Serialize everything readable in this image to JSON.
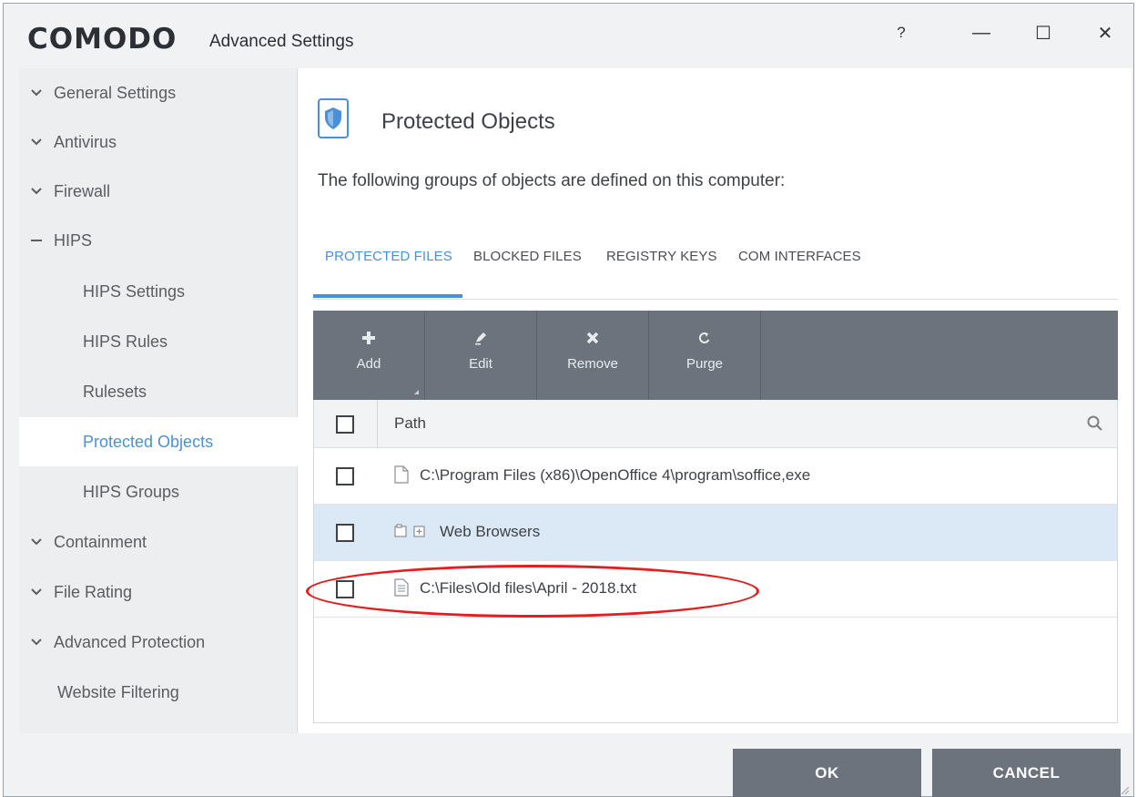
{
  "window": {
    "brand": "COMODO",
    "title": "Advanced Settings",
    "help_label": "?",
    "minimize_label": "—",
    "maximize_label": "☐",
    "close_label": "✕"
  },
  "sidebar": {
    "items": [
      {
        "label": "General Settings",
        "icon": "chevron-down-icon"
      },
      {
        "label": "Antivirus",
        "icon": "chevron-down-icon"
      },
      {
        "label": "Firewall",
        "icon": "chevron-down-icon"
      },
      {
        "label": "HIPS",
        "icon": "minus-icon"
      },
      {
        "label": "HIPS Settings"
      },
      {
        "label": "HIPS Rules"
      },
      {
        "label": "Rulesets"
      },
      {
        "label": "Protected Objects",
        "selected": true
      },
      {
        "label": "HIPS Groups"
      },
      {
        "label": "Containment",
        "icon": "chevron-down-icon"
      },
      {
        "label": "File Rating",
        "icon": "chevron-down-icon"
      },
      {
        "label": "Advanced Protection",
        "icon": "chevron-down-icon"
      },
      {
        "label": "Website Filtering"
      }
    ]
  },
  "main": {
    "title": "Protected Objects",
    "subtitle": "The following groups of objects are defined on this computer:",
    "tabs": [
      {
        "label": "PROTECTED FILES",
        "active": true
      },
      {
        "label": "BLOCKED FILES"
      },
      {
        "label": "REGISTRY KEYS"
      },
      {
        "label": "COM INTERFACES"
      }
    ],
    "toolbar": [
      {
        "label": "Add",
        "icon": "plus-icon"
      },
      {
        "label": "Edit",
        "icon": "pencil-icon"
      },
      {
        "label": "Remove",
        "icon": "x-icon"
      },
      {
        "label": "Purge",
        "icon": "refresh-icon"
      }
    ],
    "table": {
      "header": "Path",
      "rows": [
        {
          "path": "C:\\Program Files (x86)\\OpenOffice 4\\program\\soffice,exe",
          "icon": "file-icon"
        },
        {
          "path": "Web Browsers",
          "icon": "group-icon",
          "highlighted": true
        },
        {
          "path": "C:\\Files\\Old files\\April - 2018.txt",
          "icon": "text-file-icon"
        }
      ]
    }
  },
  "footer": {
    "ok_label": "OK",
    "cancel_label": "CANCEL"
  },
  "colors": {
    "accent": "#4a90d9",
    "toolbar_bg": "#6d737c",
    "highlight_row": "#dbe8f5",
    "annotation": "#e41e1e"
  }
}
